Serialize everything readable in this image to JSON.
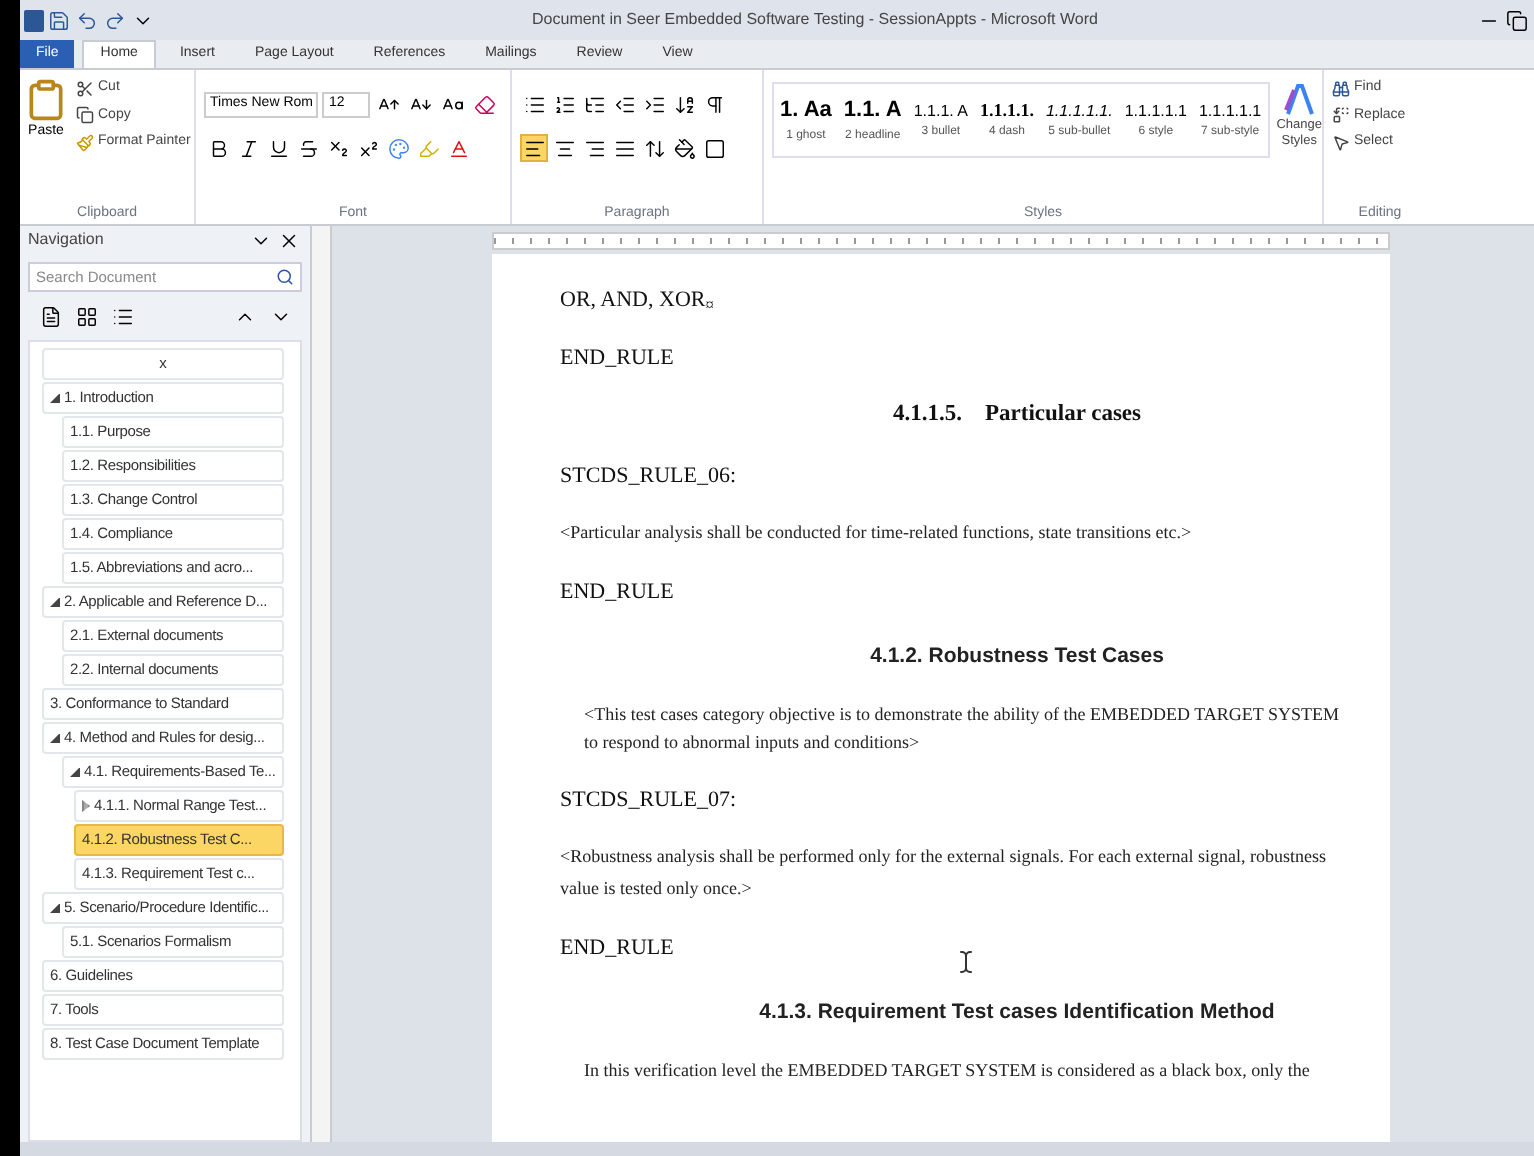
{
  "window": {
    "title": "Document in Seer Embedded Software Testing - SessionAppts - Microsoft Word"
  },
  "ribbon": {
    "tabs": [
      {
        "label": "File",
        "kind": "file",
        "selected": false
      },
      {
        "label": "Home",
        "kind": "tab",
        "selected": true
      },
      {
        "label": "Insert",
        "kind": "tab",
        "selected": false
      },
      {
        "label": "Page Layout",
        "kind": "tab",
        "selected": false
      },
      {
        "label": "References",
        "kind": "tab",
        "selected": false
      },
      {
        "label": "Mailings",
        "kind": "tab",
        "selected": false
      },
      {
        "label": "Review",
        "kind": "tab",
        "selected": false
      },
      {
        "label": "View",
        "kind": "tab",
        "selected": false
      }
    ],
    "clipboard": {
      "label": "Clipboard",
      "paste": "Paste",
      "cut": "Cut",
      "copy": "Copy",
      "format_painter": "Format Painter"
    },
    "font": {
      "label": "Font",
      "name": "Times New Rom",
      "size": "12"
    },
    "paragraph": {
      "label": "Paragraph",
      "align_buttons": [
        {
          "kind": "left",
          "selected": true
        },
        {
          "kind": "center",
          "selected": false
        },
        {
          "kind": "right",
          "selected": false
        },
        {
          "kind": "justify",
          "selected": false
        }
      ]
    },
    "styles": {
      "label": "Styles",
      "items": [
        {
          "preview": "1. Aa",
          "name": "1 ghost"
        },
        {
          "preview": "1.1. A",
          "name": "2 headline"
        },
        {
          "preview": "1.1.1. A",
          "name": "3 bullet"
        },
        {
          "preview": "1.1.1.1.",
          "name": "4 dash"
        },
        {
          "preview": "1.1.1.1.1.",
          "name": "5 sub-bullet"
        },
        {
          "preview": "1.1.1.1.1",
          "name": "6 style"
        },
        {
          "preview": "1.1.1.1.1",
          "name": "7 sub-style"
        }
      ],
      "change": "Change Styles"
    },
    "editing": {
      "label": "Editing",
      "find": "Find",
      "replace": "Replace",
      "select": "Select"
    }
  },
  "navigation": {
    "title": "Navigation",
    "search": {
      "placeholder": "Search Document"
    },
    "items": [
      {
        "label": "x",
        "expanded": false,
        "selected": false
      },
      {
        "label": "1. Introduction",
        "expanded": true,
        "selected": false,
        "children": [
          {
            "label": "1.1. Purpose",
            "expanded": false,
            "selected": false
          },
          {
            "label": "1.2. Responsibilities",
            "expanded": false,
            "selected": false
          },
          {
            "label": "1.3. Change Control",
            "expanded": false,
            "selected": false
          },
          {
            "label": "1.4. Compliance",
            "expanded": false,
            "selected": false
          },
          {
            "label": "1.5. Abbreviations and acro...",
            "expanded": false,
            "selected": false
          }
        ]
      },
      {
        "label": "2. Applicable and Reference D...",
        "expanded": true,
        "selected": false,
        "children": [
          {
            "label": "2.1. External documents",
            "expanded": false,
            "selected": false
          },
          {
            "label": "2.2. Internal documents",
            "expanded": false,
            "selected": false
          }
        ]
      },
      {
        "label": "3. Conformance to Standard",
        "expanded": false,
        "selected": false
      },
      {
        "label": "4. Method and Rules for desig...",
        "expanded": true,
        "selected": false,
        "children": [
          {
            "label": "4.1. Requirements-Based Te...",
            "expanded": true,
            "selected": false,
            "children": [
              {
                "label": "4.1.1. Normal Range Test...",
                "expanded": false,
                "has_children": true,
                "selected": false
              },
              {
                "label": "4.1.2. Robustness Test C...",
                "expanded": false,
                "selected": true
              },
              {
                "label": "4.1.3. Requirement Test c...",
                "expanded": false,
                "selected": false
              }
            ]
          }
        ]
      },
      {
        "label": "5. Scenario/Procedure Identific...",
        "expanded": true,
        "selected": false,
        "children": [
          {
            "label": "5.1. Scenarios Formalism",
            "expanded": false,
            "selected": false
          }
        ]
      },
      {
        "label": "6. Guidelines",
        "expanded": false,
        "selected": false
      },
      {
        "label": "7. Tools",
        "expanded": false,
        "selected": false
      },
      {
        "label": "8. Test Case Document Template",
        "expanded": false,
        "selected": false
      }
    ]
  },
  "document": {
    "blocks": [
      {
        "kind": "text",
        "text": "OR, AND, XOR$_{¤}$"
      },
      {
        "kind": "text",
        "text": "END_RULE"
      },
      {
        "kind": "heading_serif",
        "text": "4.1.1.5.    Particular cases"
      },
      {
        "kind": "text",
        "text": "STCDS_RULE_06:"
      },
      {
        "kind": "note",
        "text": "<Particular analysis shall be conducted for time-related functions, state transitions etc.>"
      },
      {
        "kind": "text",
        "text": "END_RULE"
      },
      {
        "kind": "heading_sans",
        "text": "4.1.2. Robustness Test Cases"
      },
      {
        "kind": "indented",
        "text": "<This test cases category objective is to demonstrate the ability of the EMBEDDED TARGET SYSTEM to respond to abnormal inputs and conditions>"
      },
      {
        "kind": "text",
        "text": "STCDS_RULE_07:"
      },
      {
        "kind": "note",
        "text": "<Robustness analysis shall be performed only for the external signals. For each external signal, robustness value is tested only once.>"
      },
      {
        "kind": "text",
        "text": "END_RULE"
      },
      {
        "kind": "heading_sans",
        "text": "4.1.3. Requirement Test cases Identification Method"
      },
      {
        "kind": "indented",
        "text": "In this verification level the EMBEDDED TARGET SYSTEM is considered as a black box, only the"
      }
    ]
  }
}
